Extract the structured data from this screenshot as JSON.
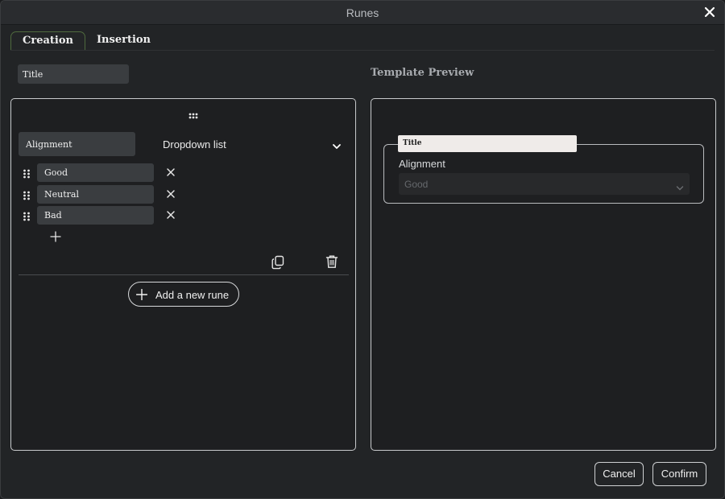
{
  "window": {
    "title": "Runes"
  },
  "tabs": [
    {
      "label": "Creation",
      "active": true
    },
    {
      "label": "Insertion",
      "active": false
    }
  ],
  "template": {
    "title_value": "Title"
  },
  "editor": {
    "rune": {
      "name_value": "Alignment",
      "type_value": "Dropdown list",
      "options": [
        "Good",
        "Neutral",
        "Bad"
      ]
    },
    "add_rune_label": "Add a new rune"
  },
  "preview": {
    "heading": "Template Preview",
    "legend": "Title",
    "field_label": "Alignment",
    "selected_value": "Good"
  },
  "footer": {
    "cancel_label": "Cancel",
    "confirm_label": "Confirm"
  },
  "icons": {
    "close": "close-icon",
    "grip": "grip-dots-icon",
    "chevron": "chevron-down-icon",
    "remove": "x-icon",
    "add": "plus-icon",
    "duplicate": "copy-icon",
    "delete": "trash-icon"
  },
  "colors": {
    "background": "#222426",
    "panel_border": "#c8cacc",
    "input_bg": "#3a3d40",
    "active_tab_border": "#4f6a3e",
    "legend_bg": "#efebe9"
  }
}
